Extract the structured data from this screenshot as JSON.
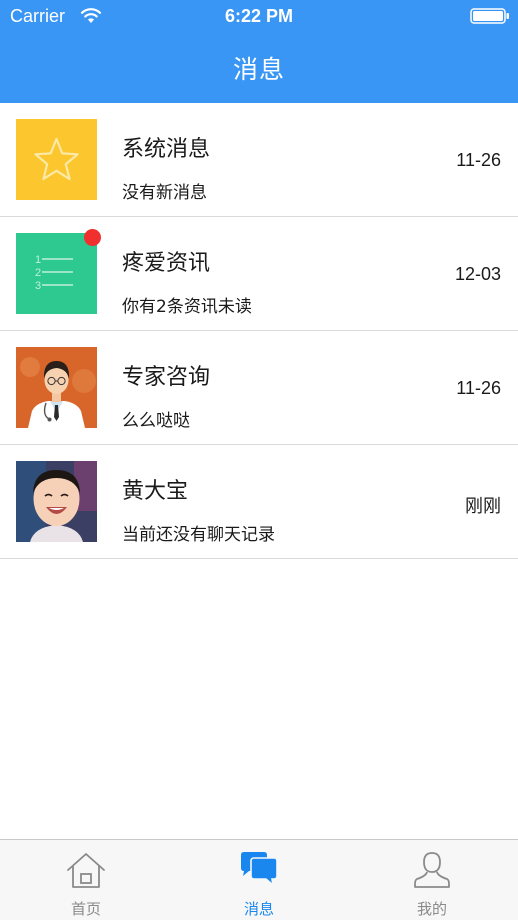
{
  "status_bar": {
    "carrier": "Carrier",
    "time": "6:22 PM"
  },
  "nav": {
    "title": "消息"
  },
  "colors": {
    "accent": "#3a96f4",
    "unread": "#f0302f",
    "tab_active": "#1a87ee",
    "tab_inactive": "#8a8a8a"
  },
  "messages": [
    {
      "title": "系统消息",
      "subtitle": "没有新消息",
      "time": "11-26",
      "icon": "star-icon",
      "unread": false
    },
    {
      "title": "疼爱资讯",
      "subtitle": "你有2条资讯未读",
      "time": "12-03",
      "icon": "numbered-list-icon",
      "unread": true
    },
    {
      "title": "专家咨询",
      "subtitle": "么么哒哒",
      "time": "11-26",
      "icon": "doctor-avatar",
      "unread": false
    },
    {
      "title": "黄大宝",
      "subtitle": "当前还没有聊天记录",
      "time": "刚刚",
      "icon": "child-photo-avatar",
      "unread": false
    }
  ],
  "tabs": [
    {
      "label": "首页",
      "icon": "home-icon",
      "active": false
    },
    {
      "label": "消息",
      "icon": "chat-bubbles-icon",
      "active": true
    },
    {
      "label": "我的",
      "icon": "person-icon",
      "active": false
    }
  ]
}
